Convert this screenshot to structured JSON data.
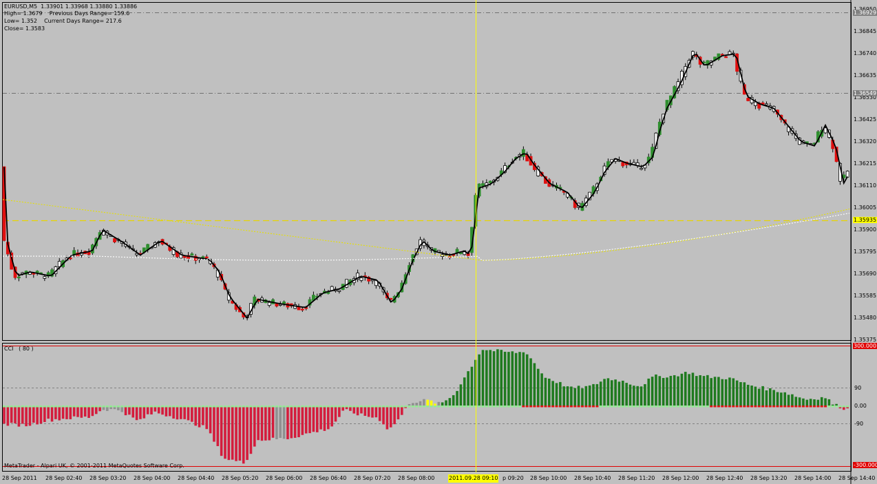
{
  "info": {
    "line1": "EURUSD,M5  1.33901 1.33968 1.33880 1.33886",
    "line2": "High= 1.3679    Previous Days Range= 159.6",
    "line3": "Low= 1.352    Current Days Range= 217.6",
    "line4": "Close= 1.3583"
  },
  "cci_title": "CCI   ( 80 )",
  "footer": "MetaTrader - Alpari UK, © 2001-2011 MetaQuotes Software Corp.",
  "price_axis": [
    "1.36950",
    "1.36845",
    "1.36740",
    "1.36635",
    "1.36530",
    "1.36425",
    "1.36320",
    "1.36215",
    "1.36110",
    "1.36005",
    "1.35900",
    "1.35795",
    "1.35690",
    "1.35585",
    "1.35480",
    "1.35375"
  ],
  "price_tags": {
    "upper": "1.36929",
    "middle": "1.36549",
    "yellow": "1.35935"
  },
  "cci_axis": {
    "top": "300.000",
    "p90": "90",
    "zero": "0.00",
    "m90": "-90",
    "bottom": "-300.000"
  },
  "time_axis": [
    "28 Sep 2011",
    "28 Sep 02:40",
    "28 Sep 03:20",
    "28 Sep 04:00",
    "28 Sep 04:40",
    "28 Sep 05:20",
    "28 Sep 06:00",
    "28 Sep 06:40",
    "28 Sep 07:20",
    "28 Sep 08:00",
    "2011.09.28 09:10",
    "p 09:20",
    "28 Sep 10:00",
    "28 Sep 10:40",
    "28 Sep 11:20",
    "28 Sep 12:00",
    "28 Sep 12:40",
    "28 Sep 13:20",
    "28 Sep 14:00",
    "28 Sep 14:40"
  ],
  "colors": {
    "background": "#c0c0c0",
    "bull": "#2f8f2f",
    "bear": "#e01010",
    "cci_neg": "#d41c3c",
    "cci_pos": "#1f7a1f",
    "crosshair": "#ffff00",
    "level": "#e00000"
  }
}
